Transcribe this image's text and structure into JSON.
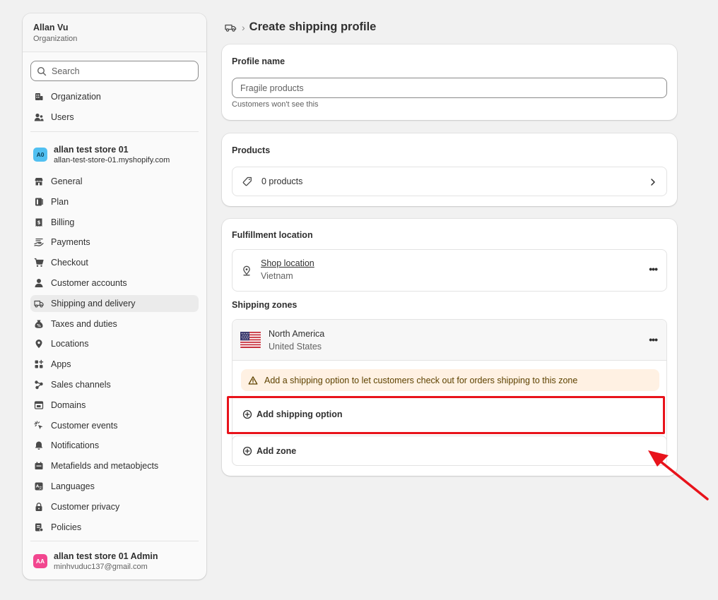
{
  "sidebar": {
    "user_name": "Allan Vu",
    "user_role": "Organization",
    "search_placeholder": "Search",
    "org_items": [
      {
        "label": "Organization",
        "icon": "organization-icon"
      },
      {
        "label": "Users",
        "icon": "users-icon"
      }
    ],
    "store": {
      "avatar_initials": "A0",
      "avatar_color": "#51c0f1",
      "name": "allan test store 01",
      "domain": "allan-test-store-01.myshopify.com"
    },
    "items": [
      {
        "label": "General",
        "icon": "store-icon"
      },
      {
        "label": "Plan",
        "icon": "plan-icon"
      },
      {
        "label": "Billing",
        "icon": "billing-icon"
      },
      {
        "label": "Payments",
        "icon": "payments-icon"
      },
      {
        "label": "Checkout",
        "icon": "cart-icon"
      },
      {
        "label": "Customer accounts",
        "icon": "person-icon"
      },
      {
        "label": "Shipping and delivery",
        "icon": "truck-icon",
        "active": true
      },
      {
        "label": "Taxes and duties",
        "icon": "tax-icon"
      },
      {
        "label": "Locations",
        "icon": "location-icon"
      },
      {
        "label": "Apps",
        "icon": "apps-icon"
      },
      {
        "label": "Sales channels",
        "icon": "channels-icon"
      },
      {
        "label": "Domains",
        "icon": "domains-icon"
      },
      {
        "label": "Customer events",
        "icon": "cursor-icon"
      },
      {
        "label": "Notifications",
        "icon": "bell-icon"
      },
      {
        "label": "Metafields and metaobjects",
        "icon": "metafields-icon"
      },
      {
        "label": "Languages",
        "icon": "languages-icon"
      },
      {
        "label": "Customer privacy",
        "icon": "lock-icon"
      },
      {
        "label": "Policies",
        "icon": "policies-icon"
      }
    ],
    "admin": {
      "avatar_initials": "AA",
      "avatar_color": "#f2468f",
      "name": "allan test store 01 Admin",
      "email": "minhvuduc137@gmail.com"
    }
  },
  "header": {
    "breadcrumb_separator": "›",
    "title": "Create shipping profile"
  },
  "profile_card": {
    "title": "Profile name",
    "input_value": "Fragile products",
    "help_text": "Customers won't see this"
  },
  "products_card": {
    "title": "Products",
    "row_label": "0 products"
  },
  "fulfillment_card": {
    "title": "Fulfillment location",
    "location_name": "Shop location",
    "location_country": "Vietnam",
    "zones_title": "Shipping zones",
    "zone": {
      "name": "North America",
      "country": "United States"
    },
    "warning_text": "Add a shipping option to let customers check out for orders shipping to this zone",
    "add_option_label": "Add shipping option",
    "add_zone_label": "Add zone"
  },
  "colors": {
    "accent_highlight": "#e8131b",
    "warning_bg": "#fff1e3"
  }
}
